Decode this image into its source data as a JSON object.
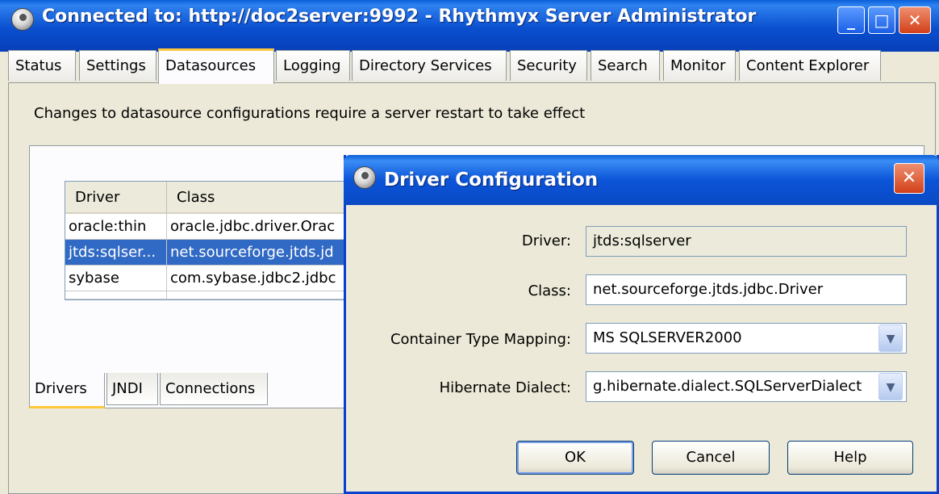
{
  "window": {
    "title": "Connected to: http://doc2server:9992 - Rhythmyx Server Administrator",
    "controls": {
      "minimize": "_",
      "maximize": "□",
      "close": "✕"
    }
  },
  "tabs": [
    {
      "label": "Status"
    },
    {
      "label": "Settings"
    },
    {
      "label": "Datasources",
      "active": true
    },
    {
      "label": "Logging"
    },
    {
      "label": "Directory Services"
    },
    {
      "label": "Security"
    },
    {
      "label": "Search"
    },
    {
      "label": "Monitor"
    },
    {
      "label": "Content Explorer"
    }
  ],
  "datasources": {
    "restart_note": "Changes to datasource configurations require a server restart to take effect",
    "table": {
      "columns": [
        "Driver",
        "Class"
      ],
      "rows": [
        {
          "driver": "oracle:thin",
          "class": "oracle.jdbc.driver.Orac",
          "selected": false
        },
        {
          "driver": "jtds:sqlser...",
          "class": "net.sourceforge.jtds.jd",
          "selected": true
        },
        {
          "driver": "sybase",
          "class": "com.sybase.jdbc2.jdbc",
          "selected": false
        }
      ]
    },
    "bottom_tabs": [
      {
        "label": "Drivers",
        "active": true
      },
      {
        "label": "JNDI"
      },
      {
        "label": "Connections"
      }
    ]
  },
  "dialog": {
    "title": "Driver Configuration",
    "close": "✕",
    "fields": {
      "driver": {
        "label": "Driver:",
        "value": "jtds:sqlserver"
      },
      "class": {
        "label": "Class:",
        "value": "net.sourceforge.jtds.jdbc.Driver"
      },
      "container": {
        "label": "Container Type Mapping:",
        "value": "MS SQLSERVER2000"
      },
      "dialect": {
        "label": "Hibernate Dialect:",
        "value": "g.hibernate.dialect.SQLServerDialect"
      }
    },
    "buttons": {
      "ok": "OK",
      "cancel": "Cancel",
      "help": "Help"
    }
  },
  "icons": {
    "app": "server-admin-icon",
    "dropdown": "chevron-down-icon"
  },
  "colors": {
    "titlebar": "#0a4fcf",
    "selection": "#316ac5",
    "tab_highlight": "#ffc83c",
    "background": "#ece9d8"
  }
}
